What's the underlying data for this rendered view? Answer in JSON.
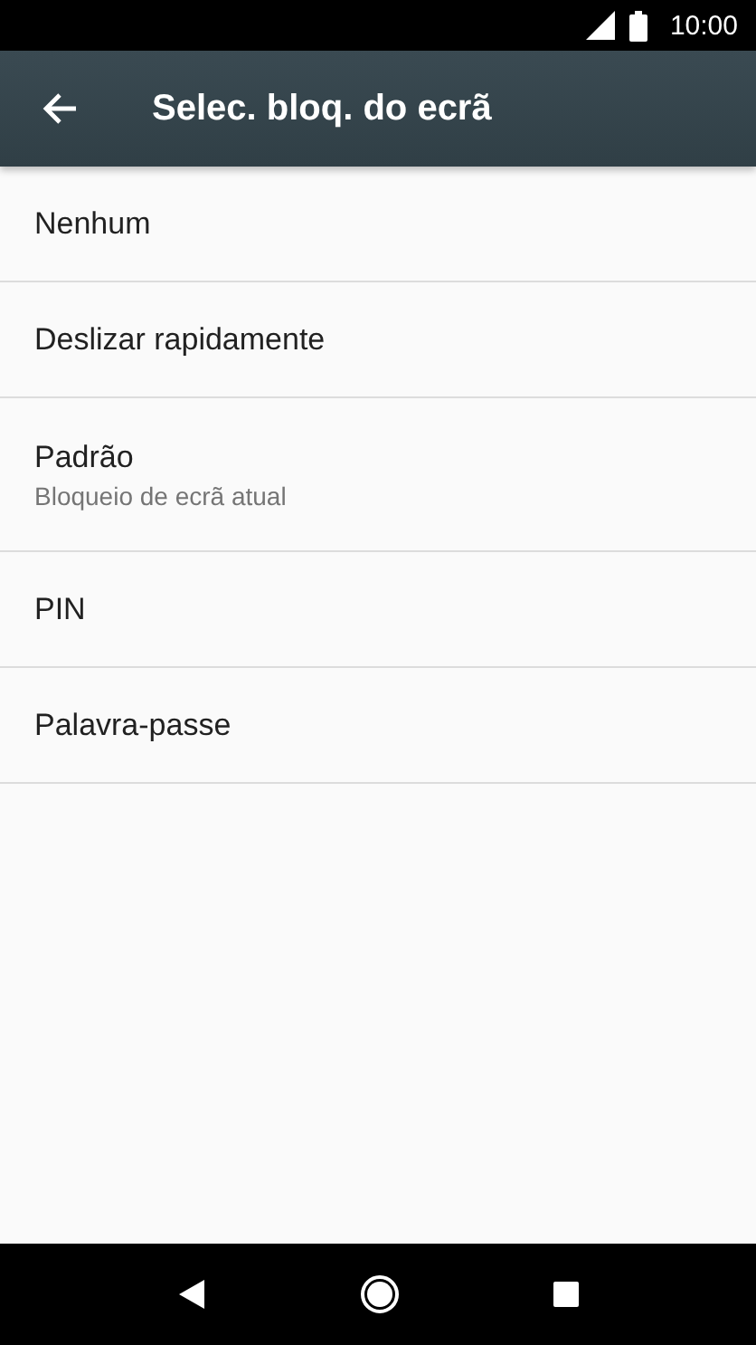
{
  "status_bar": {
    "time": "10:00"
  },
  "toolbar": {
    "title": "Selec. bloq. do ecrã"
  },
  "options": [
    {
      "title": "Nenhum"
    },
    {
      "title": "Deslizar rapidamente"
    },
    {
      "title": "Padrão",
      "subtitle": "Bloqueio de ecrã atual"
    },
    {
      "title": "PIN"
    },
    {
      "title": "Palavra-passe"
    }
  ]
}
